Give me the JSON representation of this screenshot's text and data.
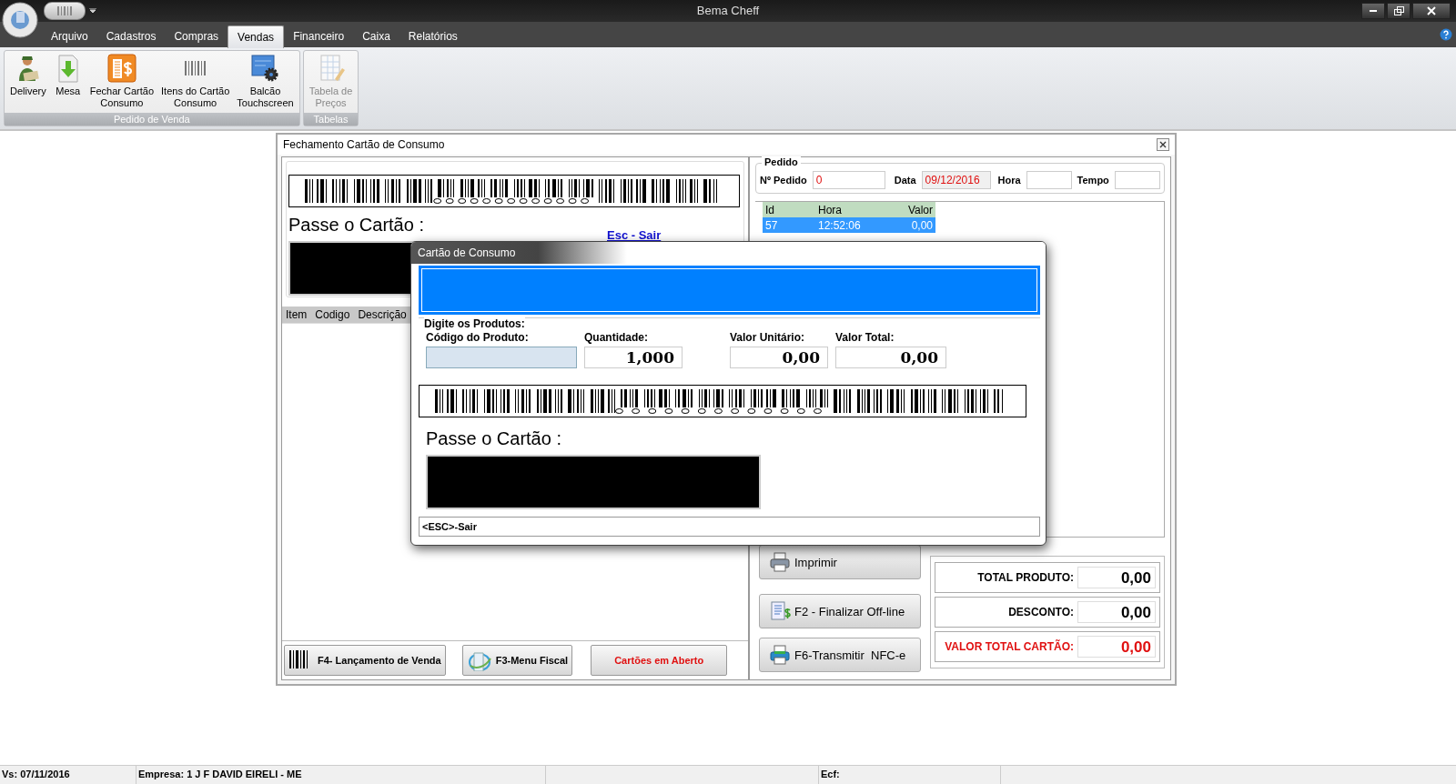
{
  "window": {
    "title": "Bema Cheff"
  },
  "menu_tabs": [
    {
      "label": "Arquivo",
      "selected": false
    },
    {
      "label": "Cadastros",
      "selected": false
    },
    {
      "label": "Compras",
      "selected": false
    },
    {
      "label": "Vendas",
      "selected": true
    },
    {
      "label": "Financeiro",
      "selected": false
    },
    {
      "label": "Caixa",
      "selected": false
    },
    {
      "label": "Relatórios",
      "selected": false
    }
  ],
  "ribbon": {
    "groups": [
      {
        "label": "Pedido de Venda",
        "buttons": [
          {
            "label": "Delivery",
            "disabled": false
          },
          {
            "label": "Mesa",
            "disabled": false
          },
          {
            "label": "Fechar Cartão\nConsumo",
            "disabled": false
          },
          {
            "label": "Itens do Cartão\nConsumo",
            "disabled": false
          },
          {
            "label": "Balcão\nTouchscreen",
            "disabled": false
          }
        ]
      },
      {
        "label": "Tabelas",
        "buttons": [
          {
            "label": "Tabela de\nPreços",
            "disabled": true
          }
        ]
      }
    ]
  },
  "card_window": {
    "title": "Fechamento Cartão de Consumo",
    "prompt": "Passe o Cartão :",
    "link": "Esc - Sair",
    "items_table": {
      "columns": [
        "Item",
        "Codigo",
        "Descrição"
      ]
    },
    "bottom_buttons": [
      {
        "label": "F4- Lançamento de Venda",
        "emphasis": false
      },
      {
        "label": "F3-Menu Fiscal",
        "emphasis": false
      },
      {
        "label": "Cartões em Aberto",
        "emphasis": true
      }
    ],
    "order": {
      "title": "Pedido",
      "fields": [
        {
          "label": "Nº Pedido",
          "value": "0",
          "disabled": false
        },
        {
          "label": "Data",
          "value": "09/12/2016",
          "disabled": true
        },
        {
          "label": "Hora",
          "disabled": false
        },
        {
          "label": "Tempo",
          "disabled": false
        }
      ]
    },
    "orders_table": {
      "columns": [
        "Id",
        "Hora",
        "Valor"
      ],
      "rows": [
        {
          "cells": [
            "57",
            "12:52:06",
            "0,00"
          ],
          "selected": true
        }
      ]
    },
    "action_buttons": [
      {
        "label": "Imprimir"
      },
      {
        "label": "F2 - Finalizar Off-line"
      },
      {
        "label": "F6-Transmitir  NFC-e"
      }
    ],
    "totals": [
      {
        "label": "TOTAL PRODUTO:",
        "value": "0,00",
        "highlight": false
      },
      {
        "label": "DESCONTO:",
        "value": "0,00",
        "highlight": false
      },
      {
        "label": "VALOR TOTAL CARTÃO:",
        "value": "0,00",
        "highlight": true
      }
    ]
  },
  "dialog": {
    "title": "Cartão de Consumo",
    "group_title": "Digite os Produtos:",
    "fields": [
      {
        "label": "Código do Produto:",
        "focused": true
      },
      {
        "label": "Quantidade:",
        "value": "1,000",
        "focused": false
      },
      {
        "label": "Valor Unitário:",
        "value": "0,00",
        "focused": false
      },
      {
        "label": "Valor Total:",
        "value": "0,00",
        "focused": false
      }
    ],
    "prompt": "Passe o Cartão :",
    "status": "<ESC>-Sair"
  },
  "status_bar": [
    "Vs: 07/11/2016",
    "Empresa: 1 J F DAVID EIRELI - ME",
    "Ecf:"
  ]
}
